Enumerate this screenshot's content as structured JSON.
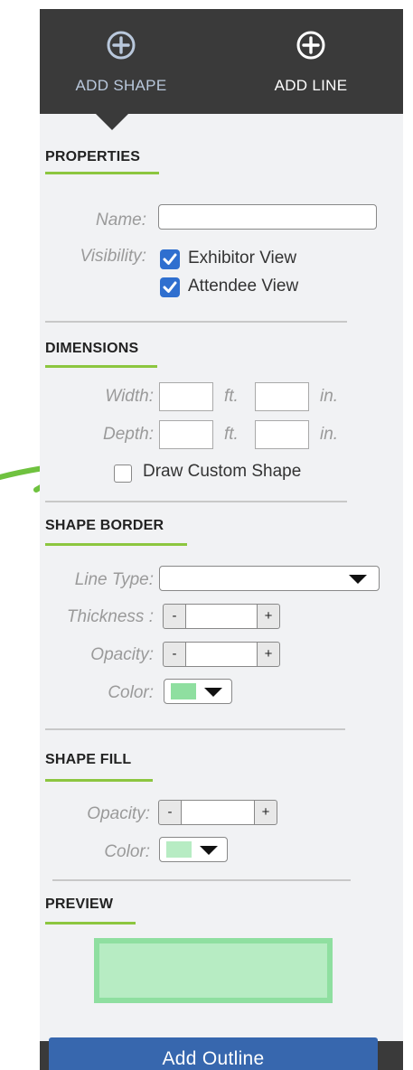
{
  "tabs": {
    "add_shape": "ADD SHAPE",
    "add_line": "ADD LINE"
  },
  "properties": {
    "title": "PROPERTIES",
    "name_label": "Name:",
    "name_value": "",
    "visibility_label": "Visibility:",
    "exhibitor_view": "Exhibitor View",
    "exhibitor_checked": true,
    "attendee_view": "Attendee View",
    "attendee_checked": true
  },
  "dimensions": {
    "title": "DIMENSIONS",
    "width_label": "Width:",
    "depth_label": "Depth:",
    "unit_ft": "ft.",
    "unit_in": "in.",
    "custom_shape_label": "Draw Custom Shape",
    "custom_shape_checked": false
  },
  "shape_border": {
    "title": "SHAPE BORDER",
    "line_type_label": "Line Type:",
    "line_type_value": "",
    "thickness_label": "Thickness :",
    "opacity_label": "Opacity:",
    "color_label": "Color:",
    "minus": "-",
    "plus": "+"
  },
  "shape_fill": {
    "title": "SHAPE FILL",
    "opacity_label": "Opacity:",
    "color_label": "Color:",
    "minus": "-",
    "plus": "+"
  },
  "preview": {
    "title": "PREVIEW"
  },
  "footer": {
    "add_outline": "Add Outline"
  },
  "colors": {
    "accent_underline": "#8cc63f",
    "border_color": "#8fdfa0",
    "fill_color": "#b7ecc3",
    "checkbox_blue": "#2f6fcf",
    "primary_button": "#3767ae",
    "annotation_arrow": "#6fc23f"
  }
}
